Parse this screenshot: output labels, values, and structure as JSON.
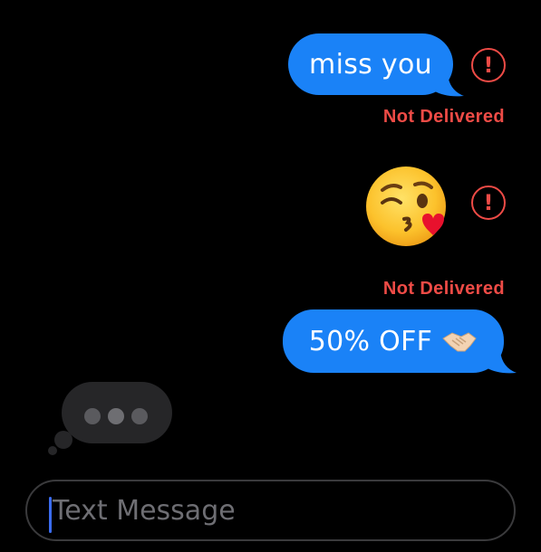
{
  "messages": [
    {
      "text": "miss you",
      "status": "Not Delivered"
    },
    {
      "emoji": "kissing-face-with-heart-emoji",
      "status": "Not Delivered"
    },
    {
      "text": "50% OFF",
      "emoji": "handshake-emoji"
    }
  ],
  "alert_glyph": "!",
  "typing_indicator": {
    "dots": 3
  },
  "composer": {
    "placeholder": "Text Message"
  },
  "colors": {
    "background": "#000000",
    "bubble": "#1a82f7",
    "error": "#ee4b46",
    "typing_bubble": "#262628",
    "caret": "#3b6cf0"
  }
}
